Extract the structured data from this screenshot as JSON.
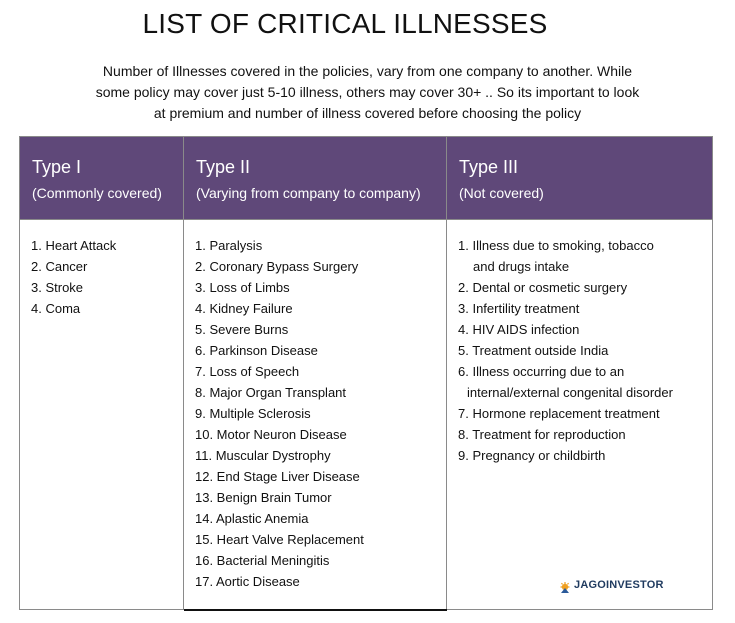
{
  "page": {
    "title": "LIST OF CRITICAL ILLNESSES",
    "intro_lines": [
      "Number of Illnesses covered in the policies, vary from one company to another. While",
      "some policy may cover just 5-10 illness, others may cover 30+ .. So its important to look",
      "at premium and number of illness covered before choosing the policy"
    ]
  },
  "colors": {
    "header_bg": "#5f4879",
    "header_text": "#ffffff",
    "border": "#8a8a8a",
    "logo_text": "#1f3a5f",
    "logo_icon_top": "#f0a020",
    "logo_icon_base": "#2a5a9a"
  },
  "table": {
    "columns": [
      {
        "title": "Type I",
        "subtitle": "(Commonly covered)",
        "items": [
          "1. Heart Attack",
          "2. Cancer",
          "3. Stroke",
          "4. Coma"
        ]
      },
      {
        "title": "Type II",
        "subtitle": "(Varying from company to company)",
        "items": [
          "1. Paralysis",
          "2. Coronary Bypass Surgery",
          "3. Loss of Limbs",
          "4. Kidney Failure",
          "5. Severe Burns",
          "6. Parkinson Disease",
          "7. Loss of Speech",
          "8. Major Organ Transplant",
          "9. Multiple Sclerosis",
          "10. Motor Neuron Disease",
          "11. Muscular Dystrophy",
          "12. End Stage Liver Disease",
          "13. Benign Brain Tumor",
          "14. Aplastic Anemia",
          "15. Heart Valve Replacement",
          "16. Bacterial Meningitis",
          "17. Aortic Disease"
        ]
      },
      {
        "title": "Type III",
        "subtitle": "(Not covered)",
        "items": [
          "1. Illness due to smoking, tobacco",
          "and drugs intake",
          "2. Dental or cosmetic surgery",
          "3. Infertility treatment",
          "4. HIV AIDS infection",
          "5. Treatment outside India",
          "6. Illness occurring due to an",
          "internal/external congenital disorder",
          "7. Hormone replacement treatment",
          "8. Treatment for reproduction",
          "9. Pregnancy or childbirth"
        ]
      }
    ]
  },
  "logo": {
    "icon": "jagoinvestor-logo-icon",
    "text": "JAGOINVESTOR"
  }
}
